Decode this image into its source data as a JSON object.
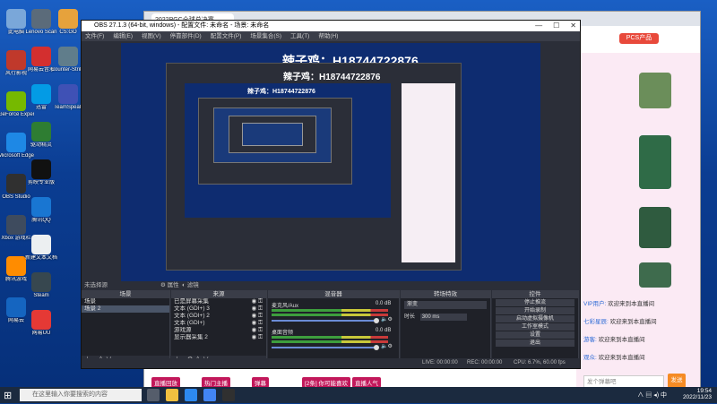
{
  "desktop": {
    "icons_left": [
      {
        "label": "此电脑",
        "color": "#7aa7d9"
      },
      {
        "label": "风行影视",
        "color": "#c0392b"
      },
      {
        "label": "GeForce Experience",
        "color": "#76b900"
      },
      {
        "label": "Microsoft Edge",
        "color": "#1e88e5"
      },
      {
        "label": "OBS Studio",
        "color": "#303030"
      },
      {
        "label": "Xbox 游戏栏",
        "color": "#3e4b5e"
      },
      {
        "label": "腾讯游戏",
        "color": "#ff8c00"
      },
      {
        "label": "网易云",
        "color": "#1565c0"
      }
    ],
    "icons_col2": [
      {
        "label": "Lenovo Scan",
        "color": "#5b6b7a"
      },
      {
        "label": "网易云音乐",
        "color": "#d32f2f"
      },
      {
        "label": "迅雷",
        "color": "#039be5"
      },
      {
        "label": "驱动精灵",
        "color": "#2e7d32"
      },
      {
        "label": "剪映专业版",
        "color": "#111111"
      },
      {
        "label": "腾讯QQ",
        "color": "#1976d2"
      },
      {
        "label": "新建文本文档",
        "color": "#eceff1"
      },
      {
        "label": "Steam",
        "color": "#37474f"
      },
      {
        "label": "网易UU",
        "color": "#e53935"
      }
    ],
    "icons_col3": [
      {
        "label": "CS:GO",
        "color": "#e6a23c"
      },
      {
        "label": "Counter-Strike",
        "color": "#607d8b"
      },
      {
        "label": "TeamSpeak",
        "color": "#3f51b5"
      }
    ]
  },
  "browser": {
    "tab_title": "2022PGC全球总决赛",
    "chat": [
      {
        "name": "VIP用户",
        "text": "欢迎来到本直播间"
      },
      {
        "name": "七彩星辰",
        "text": "欢迎来到本直播间"
      },
      {
        "name": "游客",
        "text": "欢迎来到本直播间"
      },
      {
        "name": "观众",
        "text": "欢迎来到本直播间"
      }
    ],
    "chat_placeholder": "发个弹幕吧",
    "send_label": "发送",
    "pcs_label": "PCS产品",
    "bottom_tags": [
      "直播回放",
      "热门主播",
      "弹幕",
      "[2条] 你可能喜欢",
      "直播人气"
    ]
  },
  "obs": {
    "title": "OBS 27.1.3 (64-bit, windows) - 配置文件: 未命名 - 场景: 未命名",
    "menu": [
      "文件(F)",
      "编辑(E)",
      "视图(V)",
      "停靠部件(D)",
      "配置文件(P)",
      "场景集合(S)",
      "工具(T)",
      "帮助(H)"
    ],
    "watermark": "辣子鸡：H18744722876",
    "no_source_label": "未选择源",
    "properties_label": "属性",
    "filters_label": "滤镜",
    "docks": {
      "scenes": {
        "header": "场景",
        "items": [
          "场景",
          "场景 2"
        ]
      },
      "sources": {
        "header": "来源",
        "items": [
          "已是屏幕采集",
          "文本 (GDI+) 3",
          "文本 (GDI+) 2",
          "文本 (GDI+)",
          "游戏源",
          "显示器采集 2"
        ]
      },
      "mixer": {
        "header": "混音器",
        "tracks": [
          {
            "name": "麦克风/Aux",
            "db": "0.0 dB"
          },
          {
            "name": "桌面音频",
            "db": "0.0 dB"
          }
        ]
      },
      "transitions": {
        "header": "转场特效",
        "type": "渐变",
        "duration_label": "时长",
        "duration": "300 ms"
      },
      "controls": {
        "header": "控件",
        "buttons": [
          "停止推流",
          "开始录制",
          "启动虚拟摄像机",
          "工作室模式",
          "设置",
          "退出"
        ]
      }
    },
    "status": {
      "live": "LIVE: 00:00:00",
      "rec": "REC: 00:00:00",
      "cpu": "CPU: 6.7%, 60.00 fps"
    }
  },
  "taskbar": {
    "search_placeholder": "在这里输入你要搜索的内容",
    "time": "19:54",
    "date": "2022/11/23",
    "lang": "中",
    "app_colors": [
      "#555d6b",
      "#f0c040",
      "#2d89ef",
      "#4285f4",
      "#303030"
    ]
  }
}
